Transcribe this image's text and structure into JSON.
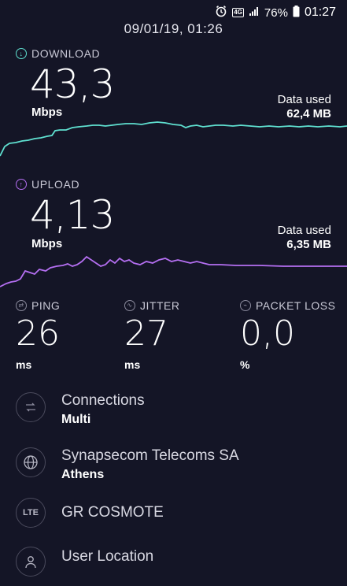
{
  "status_bar": {
    "battery": "76%",
    "time": "01:27",
    "network_badge": "4G"
  },
  "header": {
    "title": "09/01/19, 01:26"
  },
  "download": {
    "label": "DOWNLOAD",
    "value": "43,3",
    "unit": "Mbps",
    "data_used_label": "Data used",
    "data_used_value": "62,4 MB",
    "color": "#5fe0d0"
  },
  "upload": {
    "label": "UPLOAD",
    "value": "4,13",
    "unit": "Mbps",
    "data_used_label": "Data used",
    "data_used_value": "6,35 MB",
    "color": "#b56ff2"
  },
  "metrics": {
    "ping": {
      "label": "PING",
      "value": "26",
      "unit": "ms"
    },
    "jitter": {
      "label": "JITTER",
      "value": "27",
      "unit": "ms"
    },
    "packet_loss": {
      "label": "PACKET LOSS",
      "value": "0,0",
      "unit": "%"
    }
  },
  "info": {
    "connections": {
      "title": "Connections",
      "subtitle": "Multi",
      "icon": "connections-icon"
    },
    "server": {
      "title": "Synapsecom Telecoms SA",
      "subtitle": "Athens",
      "icon": "globe-icon"
    },
    "carrier": {
      "title": "GR COSMOTE",
      "icon_text": "LTE"
    },
    "location": {
      "title": "User Location",
      "icon": "person-icon"
    }
  }
}
